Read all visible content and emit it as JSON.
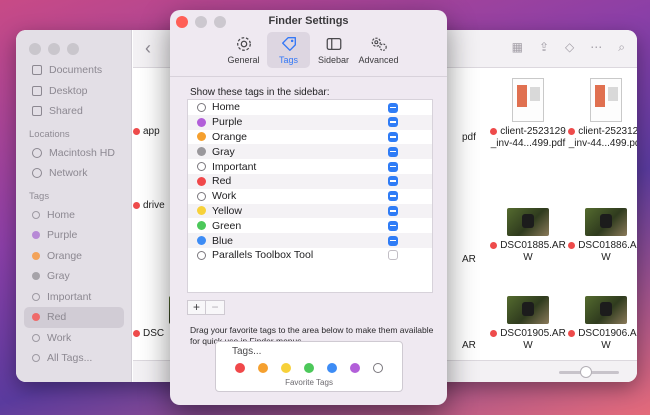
{
  "background_window": {
    "sidebar": {
      "items_top": [
        {
          "label": "Documents",
          "icon": "documents-icon"
        },
        {
          "label": "Desktop",
          "icon": "desktop-icon"
        },
        {
          "label": "Shared",
          "icon": "shared-icon"
        }
      ],
      "locations_header": "Locations",
      "locations": [
        {
          "label": "Macintosh HD",
          "icon": "disk-icon"
        },
        {
          "label": "Network",
          "icon": "network-icon"
        }
      ],
      "tags_header": "Tags",
      "tags": [
        {
          "label": "Home",
          "color": "",
          "hollow": true
        },
        {
          "label": "Purple",
          "color": "#b78ad6"
        },
        {
          "label": "Orange",
          "color": "#f3a35a"
        },
        {
          "label": "Gray",
          "color": "#a6a3a9"
        },
        {
          "label": "Important",
          "color": "",
          "hollow": true
        },
        {
          "label": "Red",
          "color": "#ef6a6a",
          "active": true
        },
        {
          "label": "Work",
          "color": "",
          "hollow": true
        },
        {
          "label": "All Tags...",
          "color": "",
          "hollow": true
        }
      ]
    },
    "files_left": [
      {
        "name": "app"
      },
      {
        "name": "drive"
      },
      {
        "name": "DSC"
      }
    ],
    "files_right": [
      {
        "name_line1": "client-2523129",
        "name_line2": "_inv-44...499.pdf",
        "partial": "pdf",
        "type": "doc"
      },
      {
        "name_line1": "client-2523129",
        "name_line2": "_inv-44...499.pdf",
        "partial": "",
        "type": "doc"
      },
      {
        "name_line1": "DSC01885.AR",
        "name_line2": "W",
        "partial": "AR",
        "type": "photo"
      },
      {
        "name_line1": "DSC01886.AR",
        "name_line2": "W",
        "partial": "",
        "type": "photo"
      },
      {
        "name_line1": "DSC01905.AR",
        "name_line2": "W",
        "partial": "AR",
        "type": "photo"
      },
      {
        "name_line1": "DSC01906.AR",
        "name_line2": "W",
        "partial": "",
        "type": "photo"
      }
    ],
    "partial_labels": {
      "a": "pdf",
      "b": "AR",
      "c": "AR",
      "d": "AR"
    }
  },
  "settings": {
    "title": "Finder Settings",
    "tabs": [
      {
        "label": "General",
        "icon": "gear-icon"
      },
      {
        "label": "Tags",
        "icon": "tag-icon",
        "selected": true
      },
      {
        "label": "Sidebar",
        "icon": "sidebar-icon"
      },
      {
        "label": "Advanced",
        "icon": "gears-icon"
      }
    ],
    "caption": "Show these tags in the sidebar:",
    "tags": [
      {
        "label": "Home",
        "color": "",
        "checked": true
      },
      {
        "label": "Purple",
        "color": "#b25fd9",
        "checked": true
      },
      {
        "label": "Orange",
        "color": "#f5a02f",
        "checked": true
      },
      {
        "label": "Gray",
        "color": "#9a989c",
        "checked": true
      },
      {
        "label": "Important",
        "color": "",
        "checked": true
      },
      {
        "label": "Red",
        "color": "#f0484a",
        "checked": true
      },
      {
        "label": "Work",
        "color": "",
        "checked": true
      },
      {
        "label": "Yellow",
        "color": "#f7d13a",
        "checked": true
      },
      {
        "label": "Green",
        "color": "#4cc85a",
        "checked": true
      },
      {
        "label": "Blue",
        "color": "#3d8cf5",
        "checked": true
      },
      {
        "label": "Parallels Toolbox Tool",
        "color": "",
        "checked": false
      }
    ],
    "add_label": "+",
    "remove_label": "−",
    "note": "Drag your favorite tags to the area below to make them available for quick use in Finder menus.",
    "favorites_label": "Tags...",
    "favorites_caption": "Favorite Tags",
    "favorite_colors": [
      "#f0484a",
      "#f5a02f",
      "#f7d13a",
      "#4cc85a",
      "#3d8cf5",
      "#b25fd9",
      ""
    ]
  }
}
